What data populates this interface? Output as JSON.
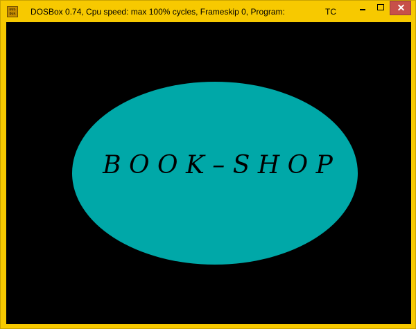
{
  "window": {
    "title": "DOSBox 0.74, Cpu speed: max 100% cycles, Frameskip  0, Program:",
    "program": "TC",
    "icon": "dosbox-icon",
    "icon_text_top": "DOS",
    "icon_text_bottom": "BOX",
    "title_bar_color": "#f7c900",
    "close_button_color": "#c7504a",
    "controls": {
      "minimize": "minimize-icon",
      "maximize": "maximize-icon",
      "close": "close-icon"
    }
  },
  "screen": {
    "background_color": "#000000",
    "ellipse_color": "#00a8a8",
    "text": "B O O K – S H O P",
    "text_color": "#000000"
  }
}
